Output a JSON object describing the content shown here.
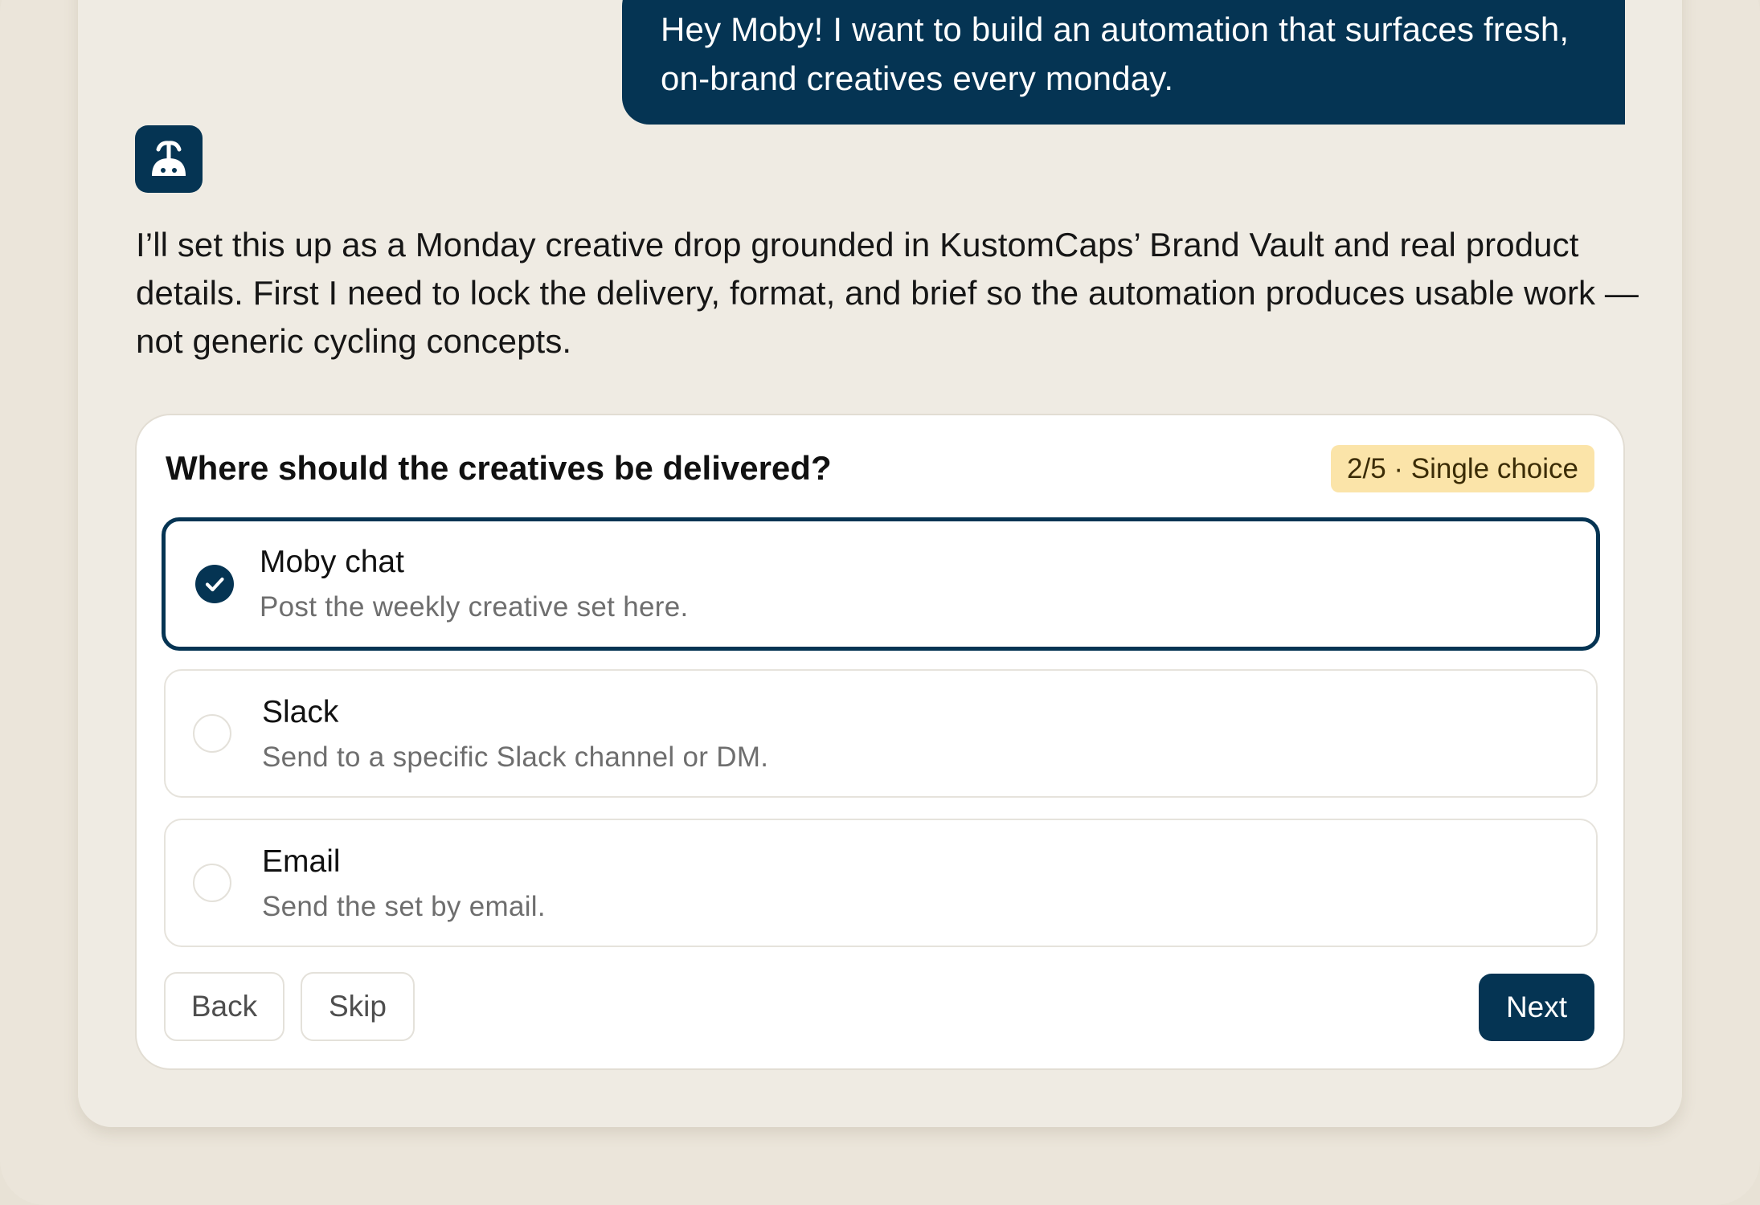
{
  "chat": {
    "user_message": "Hey Moby! I want to build an automation that surfaces fresh, on-brand creatives every monday.",
    "assistant_avatar_icon": "whale-icon",
    "assistant_message": "I’ll set this up as a Monday creative drop grounded in KustomCaps’ Brand Vault and real product details. First I need to lock the delivery, format, and brief so the automation produces usable work — not generic cycling concepts."
  },
  "question_card": {
    "question": "Where should the creatives be delivered?",
    "badge": "2/5 · Single choice",
    "options": [
      {
        "title": "Moby chat",
        "description": "Post the weekly creative set here.",
        "selected": true
      },
      {
        "title": "Slack",
        "description": "Send to a specific Slack channel or DM.",
        "selected": false
      },
      {
        "title": "Email",
        "description": "Send the set by email.",
        "selected": false
      }
    ],
    "back_label": "Back",
    "skip_label": "Skip",
    "next_label": "Next"
  },
  "colors": {
    "primary": "#053453",
    "badge_bg": "#fbe4a9",
    "page_bg": "#e8e2d6",
    "panel_bg": "#efebe3"
  }
}
